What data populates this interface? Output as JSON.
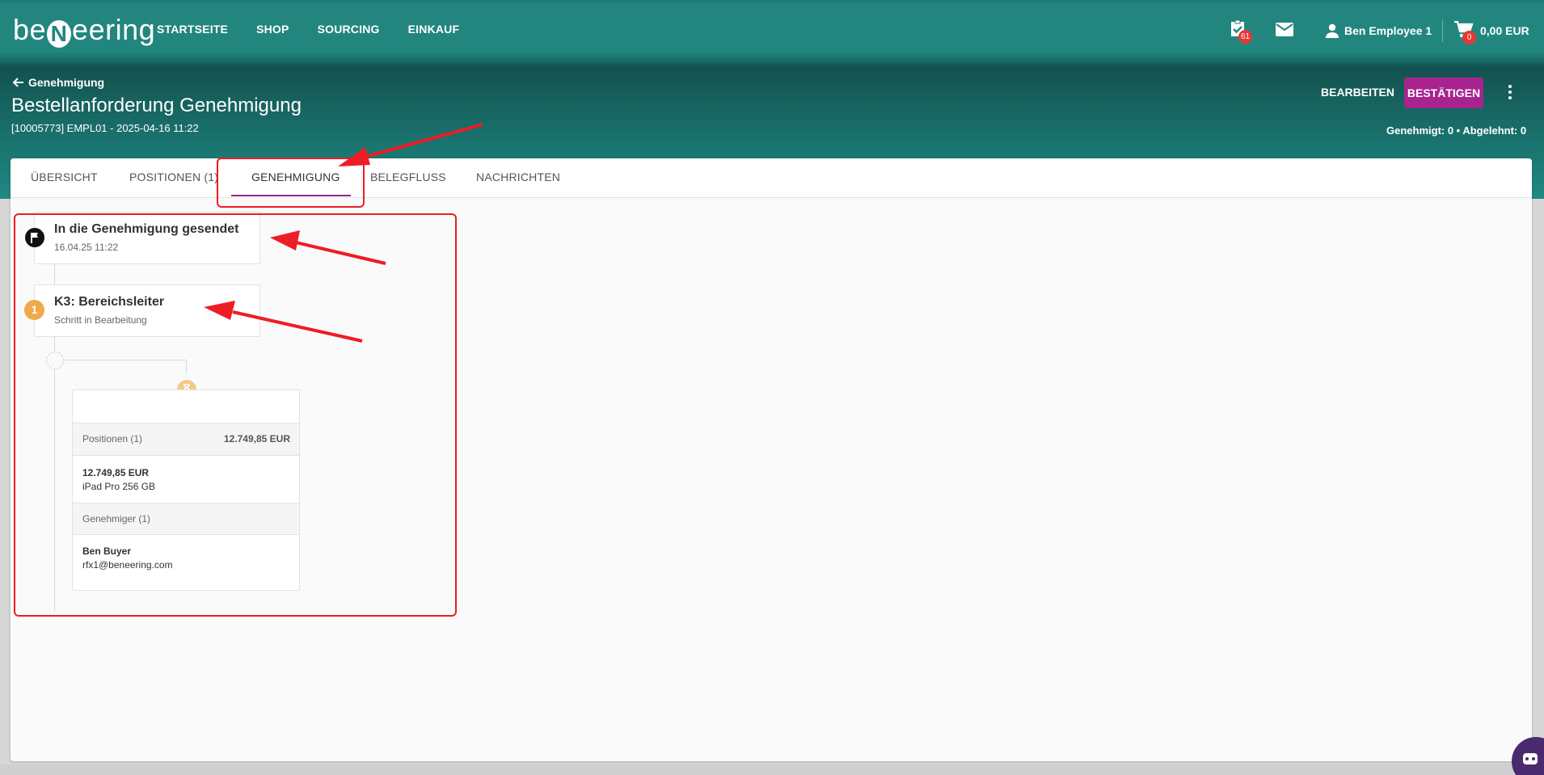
{
  "header": {
    "logo": {
      "prefix": "be",
      "mark": "N",
      "suffix": "eering"
    },
    "nav": [
      "STARTSEITE",
      "SHOP",
      "SOURCING",
      "EINKAUF"
    ],
    "tasks_badge": "61",
    "user_name": "Ben Employee 1",
    "cart_badge": "0",
    "cart_total": "0,00 EUR",
    "icons": [
      "task-check-icon",
      "mail-icon",
      "person-icon",
      "cart-icon"
    ]
  },
  "page": {
    "back_label": "Genehmigung",
    "title": "Bestellanforderung Genehmigung",
    "subtitle": "[10005773] EMPL01 - 2025-04-16 11:22",
    "edit_label": "BEARBEITEN",
    "confirm_label": "BESTÄTIGEN",
    "approval_summary": "Genehmigt: 0 • Abgelehnt: 0"
  },
  "tabs": [
    {
      "label": "ÜBERSICHT"
    },
    {
      "label": "POSITIONEN (1)"
    },
    {
      "label": "GENEHMIGUNG"
    },
    {
      "label": "BELEGFLUSS"
    },
    {
      "label": "NACHRICHTEN"
    }
  ],
  "active_tab": "GENEHMIGUNG",
  "timeline": {
    "sent": {
      "title": "In die Genehmigung gesendet",
      "date": "16.04.25 11:22"
    },
    "step": {
      "number": "1",
      "title": "K3: Bereichsleiter",
      "status": "Schritt in Bearbeitung"
    },
    "detail": {
      "positions_label": "Positionen (1)",
      "positions_total": "12.749,85 EUR",
      "item_price": "12.749,85 EUR",
      "item_name": "iPad Pro 256 GB",
      "approvers_label": "Genehmiger (1)",
      "approver_name": "Ben Buyer",
      "approver_email": "rfx1@beneering.com"
    }
  },
  "colors": {
    "header": "#22867f",
    "accent": "#a7248f",
    "tab_underline": "#8e2a86",
    "step_pending": "#f0a94a",
    "annotation": "#ee1c24"
  }
}
